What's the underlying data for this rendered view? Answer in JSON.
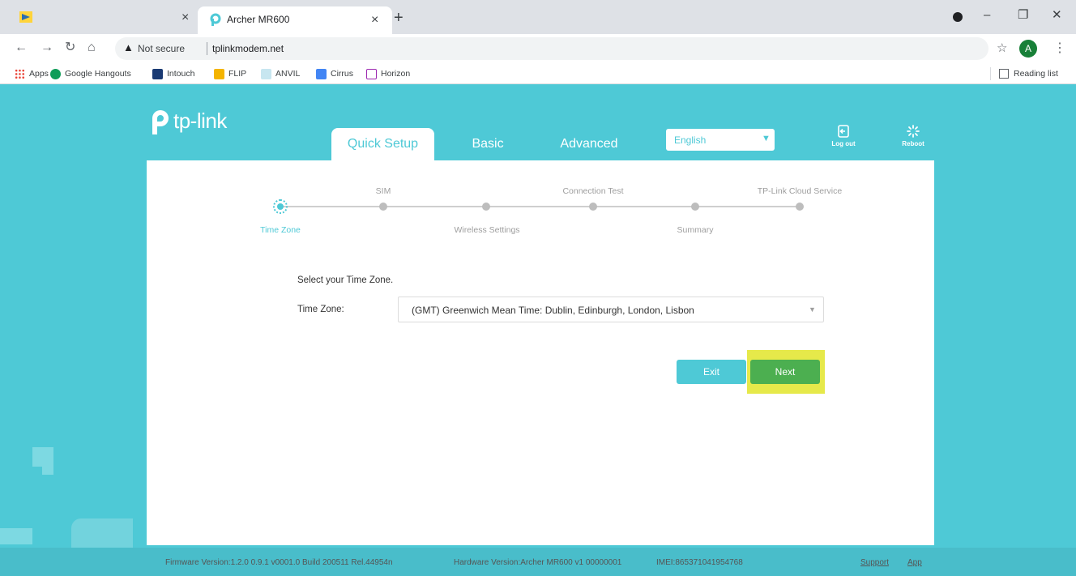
{
  "browser": {
    "active_tab_title": "Archer MR600",
    "url_security": "Not secure",
    "url": "tplinkmodem.net",
    "profile_initial": "A",
    "bookmarks": [
      {
        "label": "Apps",
        "color": "#e94235"
      },
      {
        "label": "Google Hangouts",
        "color": "#0f9d58"
      },
      {
        "label": "Intouch",
        "color": "#1a3a73"
      },
      {
        "label": "FLIP",
        "color": "#f4b400"
      },
      {
        "label": "ANVIL",
        "color": "#c7e6f0"
      },
      {
        "label": "Cirrus",
        "color": "#4285f4"
      },
      {
        "label": "Horizon",
        "color": "#9c27b0"
      }
    ],
    "reading_list": "Reading list"
  },
  "router": {
    "brand": "tp-link",
    "tabs": [
      "Quick Setup",
      "Basic",
      "Advanced"
    ],
    "language": "English",
    "logout_label": "Log out",
    "reboot_label": "Reboot",
    "steps": {
      "top": [
        "SIM",
        "Connection Test",
        "TP-Link Cloud Service"
      ],
      "bottom": [
        "Time Zone",
        "Wireless Settings",
        "Summary"
      ]
    },
    "prompt": "Select your Time Zone.",
    "tz_label": "Time Zone:",
    "tz_value": "(GMT) Greenwich Mean Time: Dublin, Edinburgh, London, Lisbon",
    "exit_label": "Exit",
    "next_label": "Next",
    "footer": {
      "firmware": "Firmware Version:1.2.0 0.9.1 v0001.0 Build 200511 Rel.44954n",
      "hardware": "Hardware Version:Archer MR600 v1 00000001",
      "imei": "IMEI:865371041954768",
      "support": "Support",
      "app": "App"
    }
  },
  "colors": {
    "teal": "#4ec9d6",
    "next_green": "#4caf50",
    "highlight": "#e6e94a"
  }
}
